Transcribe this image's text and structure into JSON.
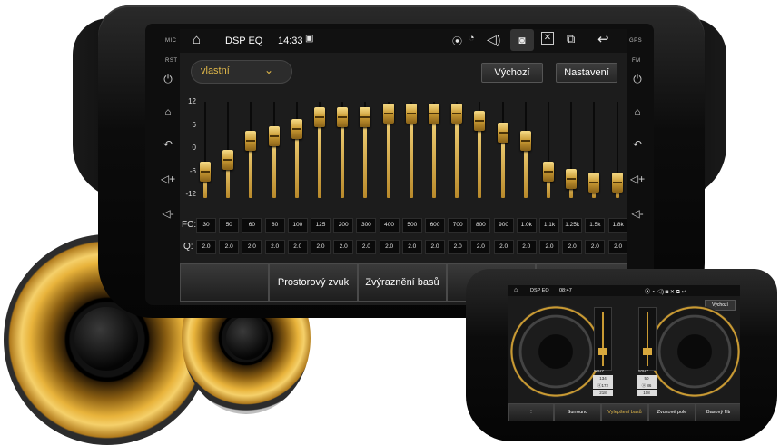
{
  "side_left": {
    "mic": "MIC",
    "rst": "RST"
  },
  "side_right": {
    "gps": "GPS",
    "fm": "FM"
  },
  "status": {
    "title": "DSP EQ",
    "time": "14:33"
  },
  "icons": [
    "home-icon",
    "image-icon",
    "location-icon",
    "wifi-icon",
    "volume-icon",
    "camera-icon",
    "close-icon",
    "windows-icon",
    "back-icon"
  ],
  "preset": {
    "value": "vlastní"
  },
  "buttons": {
    "default": "Výchozí",
    "settings": "Nastavení"
  },
  "eq": {
    "y_ticks": [
      "12",
      "6",
      "0",
      "-6",
      "-12"
    ],
    "fc_label": "FC:",
    "q_label": "Q:",
    "bands": [
      {
        "fc": "30",
        "q": "2.0",
        "gain": -6
      },
      {
        "fc": "50",
        "q": "2.0",
        "gain": -3
      },
      {
        "fc": "60",
        "q": "2.0",
        "gain": 2
      },
      {
        "fc": "80",
        "q": "2.0",
        "gain": 3
      },
      {
        "fc": "100",
        "q": "2.0",
        "gain": 5
      },
      {
        "fc": "125",
        "q": "2.0",
        "gain": 8
      },
      {
        "fc": "200",
        "q": "2.0",
        "gain": 8
      },
      {
        "fc": "300",
        "q": "2.0",
        "gain": 8
      },
      {
        "fc": "400",
        "q": "2.0",
        "gain": 9
      },
      {
        "fc": "500",
        "q": "2.0",
        "gain": 9
      },
      {
        "fc": "600",
        "q": "2.0",
        "gain": 9
      },
      {
        "fc": "700",
        "q": "2.0",
        "gain": 9
      },
      {
        "fc": "800",
        "q": "2.0",
        "gain": 7
      },
      {
        "fc": "900",
        "q": "2.0",
        "gain": 4
      },
      {
        "fc": "1.0k",
        "q": "2.0",
        "gain": 2
      },
      {
        "fc": "1.1k",
        "q": "2.0",
        "gain": -6
      },
      {
        "fc": "1.25k",
        "q": "2.0",
        "gain": -8
      },
      {
        "fc": "1.5k",
        "q": "2.0",
        "gain": -9
      },
      {
        "fc": "1.8k",
        "q": "2.0",
        "gain": -9
      }
    ]
  },
  "tabs": [
    "",
    "Prostorový zvuk",
    "Zvýraznění basů",
    "",
    ""
  ],
  "unit2": {
    "title": "DSP EQ",
    "time": "08:47",
    "default": "Výchozí",
    "meters": [
      "50HZ",
      "50HZ"
    ],
    "readouts_left": [
      "134",
      "ⓐ172",
      "218"
    ],
    "readouts_right": [
      "50",
      "ⓐ 86",
      "108"
    ],
    "tabs": [
      "",
      "Surround",
      "Vylepšení basů",
      "Zvukové pole",
      "Basový filtr"
    ]
  },
  "colors": {
    "gold": "#d9a93e",
    "accent_text": "#e0b84a",
    "bg": "#1c1c1c"
  }
}
